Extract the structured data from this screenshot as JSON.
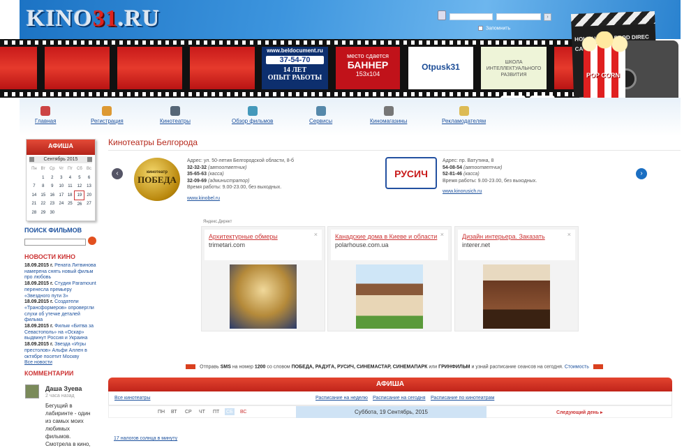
{
  "site": {
    "logo_left": "KINO",
    "logo_mid": "31",
    "logo_right": ".RU"
  },
  "login": {
    "remember": "Запомнить"
  },
  "banners": {
    "ad1": {
      "url": "www.beldocument.ru",
      "phone": "37-54-70",
      "years": "14 ЛЕТ",
      "exp": "ОПЫТ РАБОТЫ"
    },
    "ad2": {
      "line1": "место сдается",
      "line2": "БАННЕР",
      "line3": "153x104"
    },
    "ad3": {
      "text": "Otpusk31"
    },
    "ad4": {
      "text": "ШКОЛА ИНТЕЛЛЕКТУАЛЬНОГО РАЗВИТИЯ"
    }
  },
  "props": {
    "board": "HOLLY WOOD PROD DIREC CAME DATE",
    "popcorn": "POP CORN"
  },
  "nav": [
    "Главная",
    "Регистрация",
    "Кинотеатры",
    "Обзор фильмов",
    "Сервисы",
    "Киномагазины",
    "Рекламодателям"
  ],
  "calendar": {
    "title": "АФИША",
    "month": "Сентябрь 2015",
    "head": [
      "Пн",
      "Вт",
      "Ср",
      "Чт",
      "Пт",
      "Сб",
      "Вс"
    ],
    "rows": [
      [
        "",
        "1",
        "2",
        "3",
        "4",
        "5",
        "6"
      ],
      [
        "7",
        "8",
        "9",
        "10",
        "11",
        "12",
        "13"
      ],
      [
        "14",
        "15",
        "16",
        "17",
        "18",
        "19",
        "20"
      ],
      [
        "21",
        "22",
        "23",
        "24",
        "25",
        "26",
        "27"
      ],
      [
        "28",
        "29",
        "30",
        "",
        "",
        "",
        ""
      ]
    ]
  },
  "search": {
    "title": "ПОИСК ФИЛЬМОВ"
  },
  "news": {
    "title": "НОВОСТИ КИНО",
    "items": [
      {
        "date": "18.09.2015 г.",
        "text": "Рената Литвинова намерена снять новый фильм про любовь"
      },
      {
        "date": "18.09.2015 г.",
        "text": "Студия Paramount перенесла премьеру «Звездного пути 3»"
      },
      {
        "date": "18.09.2015 г.",
        "text": "Создатели «Трансформеров» опровергли слухи об утечке деталей фильма"
      },
      {
        "date": "18.09.2015 г.",
        "text": "Фильм «Битва за Севастополь» на «Оскар» выдвинут Россия и Украина"
      },
      {
        "date": "18.09.2015 г.",
        "text": "Звезда «Игры престолов» Альфи Аллен в октябре посетит Москву"
      }
    ],
    "all": "Все новости"
  },
  "comments": {
    "title": "КОММЕНТАРИИ",
    "name": "Даша Зуева",
    "time": "2 часа назад",
    "text": "Бегущий в лабиринте - один из самых моих любимых фильмов. Смотрела в кино,"
  },
  "main": {
    "title": "Кинотеатры Белгорода",
    "cinema1": {
      "logo_small": "кинотеатр",
      "logo_big": "ПОБЕДА",
      "address": "Адрес: ул. 50-летия Белгородской области, 8-б",
      "p1": "32-32-32",
      "p1n": "(автоответчик)",
      "p2": "35-65-63",
      "p2n": "(касса)",
      "p3": "32-09-69",
      "p3n": "(администратор)",
      "hours": "Время работы: 9.00-23.00, без выходных.",
      "url": "www.kinobel.ru"
    },
    "cinema2": {
      "logo": "РУСИЧ",
      "address": "Адрес: пр. Ватутина, 8",
      "p1": "54-08-54",
      "p1n": "(автоответчик)",
      "p2": "52-81-46",
      "p2n": "(касса)",
      "hours": "Время работы: 9.00-23.00, без выходных.",
      "url": "www.kinorusich.ru"
    },
    "direct": {
      "label": "Яндекс.Директ",
      "ads": [
        {
          "title": "Архитектурные обмеры",
          "domain": "trimetari.com"
        },
        {
          "title": "Канадские дома в Киеве и области",
          "domain": "polarhouse.com.ua"
        },
        {
          "title": "Дизайн интерьера. Заказать",
          "domain": "interer.net"
        }
      ]
    },
    "sms": {
      "a": "Отправь",
      "b": "SMS",
      "c": "на номер",
      "num": "1200",
      "d": "со словом",
      "words": "ПОБЕДА, РАДУГА, РУСИЧ, СИНЕМАСТАР, СИНЕМАПАРК",
      "e": "или",
      "w2": "ГРИНФИЛЬМ",
      "f": "и узнай расписание сеансов на сегодня.",
      "cost": "Стоимость"
    },
    "afisha": {
      "title": "АФИША",
      "all": "Все кинотеатры",
      "links": [
        "Расписание на неделю",
        "Расписание на сегодня",
        "Расписание по кинотеатрам"
      ],
      "days": [
        "ПН",
        "ВТ",
        "СР",
        "ЧТ",
        "ПТ",
        "СБ",
        "ВС"
      ],
      "date": "Суббота, 19 Сентябрь, 2015",
      "next": "Следующий день",
      "bottom": "17 налогов солнца в минуту"
    }
  },
  "colors": {
    "accent": "#c81a1a",
    "link": "#1a4f9c",
    "sky": "#3d95de"
  }
}
